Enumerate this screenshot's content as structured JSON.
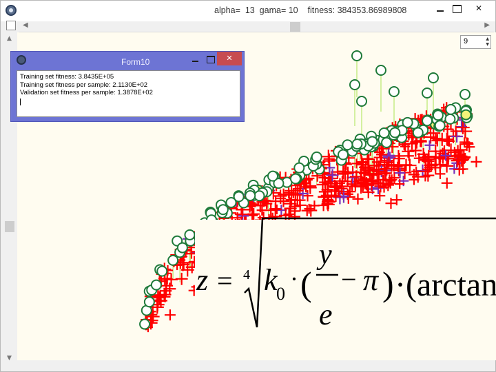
{
  "window": {
    "title": "alpha=  13  gama= 10    fitness: 384353.86989808",
    "close_label": "✕"
  },
  "toolbar": {
    "spin_value": "9"
  },
  "form10": {
    "title": "Form10",
    "close_label": "✕",
    "memo_lines": [
      "Training set fitness: 3.8435E+05",
      "Training set fitness per sample: 2.1130E+02",
      "Validation set fitness per sample: 1.3878E+02"
    ]
  },
  "formula": {
    "lhs": "z",
    "equals": "=",
    "root_index": "4",
    "k": "k",
    "k_sub": "0",
    "dot": "·",
    "paren_open": "(",
    "numerator": "y",
    "denominator": "e",
    "minus": "−",
    "pi": "π",
    "paren_close": ")",
    "arctan_part": "·(arctan"
  },
  "colors": {
    "cross": "#ff0000",
    "cross_alt": "#7a2fb8",
    "circle_stroke": "#1f7a3a",
    "circle_fill": "#ffffff",
    "circle_highlight": "#f4f47a",
    "stem": "#b8e86a",
    "plot_bg": "#fffcf0"
  },
  "icons": [
    "app-icon",
    "minimize-icon",
    "maximize-icon",
    "close-icon",
    "form10-icon"
  ]
}
